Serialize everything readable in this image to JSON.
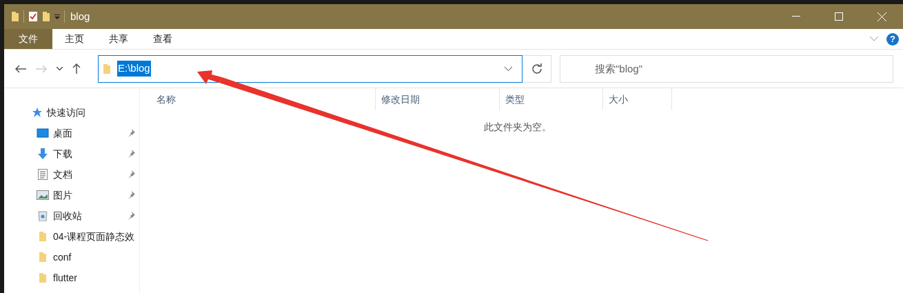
{
  "window": {
    "title": "blog"
  },
  "ribbon_tabs": [
    {
      "label": "文件",
      "selected": true
    },
    {
      "label": "主页",
      "selected": false
    },
    {
      "label": "共享",
      "selected": false
    },
    {
      "label": "查看",
      "selected": false
    }
  ],
  "help": {
    "label": "?"
  },
  "address": {
    "value": "E:\\blog",
    "selected": true
  },
  "search": {
    "placeholder": "搜索\"blog\""
  },
  "sidebar": {
    "items": [
      {
        "label": "快速访问",
        "kind": "star",
        "pinned": false,
        "children": [
          {
            "label": "桌面",
            "kind": "desktop",
            "pinned": true
          },
          {
            "label": "下载",
            "kind": "download",
            "pinned": true
          },
          {
            "label": "文档",
            "kind": "document",
            "pinned": true
          },
          {
            "label": "图片",
            "kind": "pictures",
            "pinned": true
          },
          {
            "label": "回收站",
            "kind": "recycle",
            "pinned": true
          },
          {
            "label": "04-课程页面静态效",
            "kind": "folder",
            "pinned": false
          },
          {
            "label": "conf",
            "kind": "folder",
            "pinned": false
          },
          {
            "label": "flutter",
            "kind": "folder",
            "pinned": false
          }
        ]
      }
    ]
  },
  "table": {
    "columns": [
      "名称",
      "修改日期",
      "类型",
      "大小"
    ],
    "empty_message": "此文件夹为空。"
  }
}
